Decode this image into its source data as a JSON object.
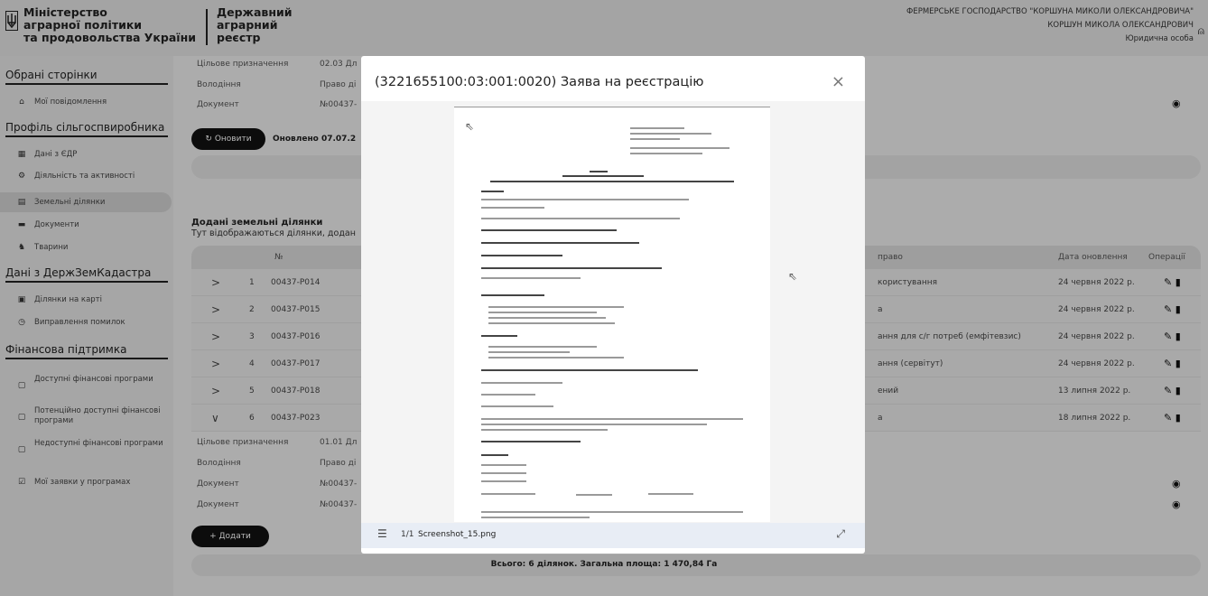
{
  "header": {
    "ministry": [
      "Міністерство",
      "аграрної політики",
      "та продовольства України"
    ],
    "registry": [
      "Державний",
      "аграрний",
      "реєстр"
    ],
    "farm": "ФЕРМЕРСЬКЕ ГОСПОДАРСТВО \"КОРШУНА МИКОЛИ ОЛЕКСАНДРОВИЧА\"",
    "user": "КОРШУН МИКОЛА ОЛЕКСАНДРОВИЧ",
    "role": "Юридична особа",
    "user_icon": "user-icon"
  },
  "sidebar": {
    "s1": "Обрані сторінки",
    "notifications": "Мої повідомлення",
    "s2": "Профіль сільгоспвиробника",
    "edr": "Дані з ЄДР",
    "activity": "Діяльність та активності",
    "land": "Земельні ділянки",
    "docs": "Документи",
    "animals": "Тварини",
    "s3": "Дані з ДержЗемКадастра",
    "map": "Ділянки на карті",
    "fix": "Виправлення помилок",
    "s4": "Фінансова підтримка",
    "available": "Доступні фінансові програми",
    "potential": "Потенційно доступні фінансові програми",
    "unavailable": "Недоступні фінансові програми",
    "my_apps": "Мої заявки у програмах"
  },
  "main": {
    "top_rows": [
      {
        "k": "Цільове призначення",
        "v": "02.03 Дл"
      },
      {
        "k": "Володіння",
        "v": "Право ді"
      },
      {
        "k": "Документ",
        "v": "№00437-"
      }
    ],
    "refresh": "Оновити",
    "updated": "Оновлено 07.07.2",
    "added_title": "Додані земельні ділянки",
    "added_sub": "Тут відображаються ділянки, додан",
    "cols": {
      "num": "№",
      "right": "право",
      "date": "Дата оновлення",
      "ops": "Операції"
    },
    "rows": [
      {
        "n": "1",
        "code": "00437-P014",
        "right": "користування",
        "date": "24 червня 2022 р.",
        "chev": ">"
      },
      {
        "n": "2",
        "code": "00437-P015",
        "right": "а",
        "date": "24 червня 2022 р.",
        "chev": ">"
      },
      {
        "n": "3",
        "code": "00437-P016",
        "right": "ання для с/г потреб (емфітевзис)",
        "date": "24 червня 2022 р.",
        "chev": ">"
      },
      {
        "n": "4",
        "code": "00437-P017",
        "right": "ання (сервітут)",
        "date": "24 червня 2022 р.",
        "chev": ">"
      },
      {
        "n": "5",
        "code": "00437-P018",
        "right": "ений",
        "date": "13 липня 2022 р.",
        "chev": ">"
      },
      {
        "n": "6",
        "code": "00437-P023",
        "right": "а",
        "date": "18 липня 2022 р.",
        "chev": "∨"
      }
    ],
    "bottom_rows": [
      {
        "k": "Цільове призначення",
        "v": "01.01 Дл"
      },
      {
        "k": "Володіння",
        "v": "Право ді"
      },
      {
        "k": "Документ",
        "v": "№00437-"
      },
      {
        "k": "Документ",
        "v": "№00437-"
      }
    ],
    "add": "Додати",
    "total": "Всього: 6 ділянок. Загальна площа: 1 470,84 Га"
  },
  "modal": {
    "title": "(3221655100:03:001:0020) Заява на реєстрацію",
    "close": "×",
    "page": "1/1",
    "filename": "Screenshot_15.png"
  },
  "colors": {
    "overlay": "#000000",
    "button": "#111111",
    "footer": "#e8edf5"
  }
}
